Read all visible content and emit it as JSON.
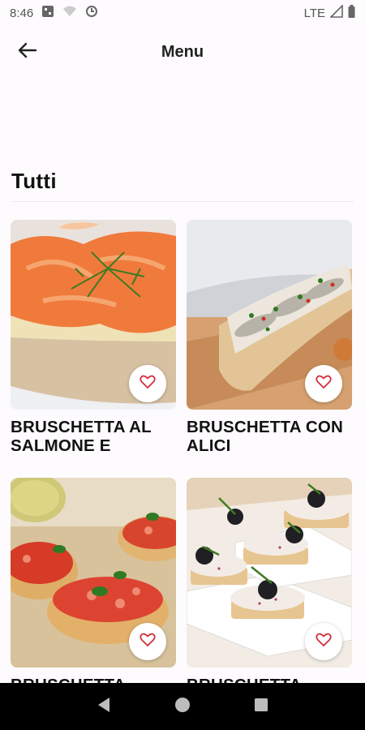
{
  "status_bar": {
    "time": "8:46",
    "network": "LTE",
    "icons": [
      "notification-icon",
      "wifi-icon",
      "data-saver-icon",
      "signal-icon",
      "battery-icon"
    ]
  },
  "app_bar": {
    "title": "Menu",
    "back_icon": "arrow-left-icon"
  },
  "section": {
    "title": "Tutti"
  },
  "cards": [
    {
      "title": "BRUSCHETTA AL SALMONE E",
      "image": "salmon-bruschetta-photo",
      "favorite_icon": "heart-outline-icon"
    },
    {
      "title": "BRUSCHETTA CON ALICI",
      "image": "anchovy-bruschetta-photo",
      "favorite_icon": "heart-outline-icon"
    },
    {
      "title": "BRUSCHETTA",
      "image": "tomato-bruschetta-photo",
      "favorite_icon": "heart-outline-icon"
    },
    {
      "title": "BRUSCHETTA",
      "image": "olive-canape-photo",
      "favorite_icon": "heart-outline-icon"
    }
  ],
  "colors": {
    "background": "#fdfbfd",
    "heart": "#d22d3d",
    "nav_bar": "#000000"
  },
  "nav_bar": {
    "buttons": [
      "back-triangle-icon",
      "home-circle-icon",
      "recents-square-icon"
    ]
  }
}
